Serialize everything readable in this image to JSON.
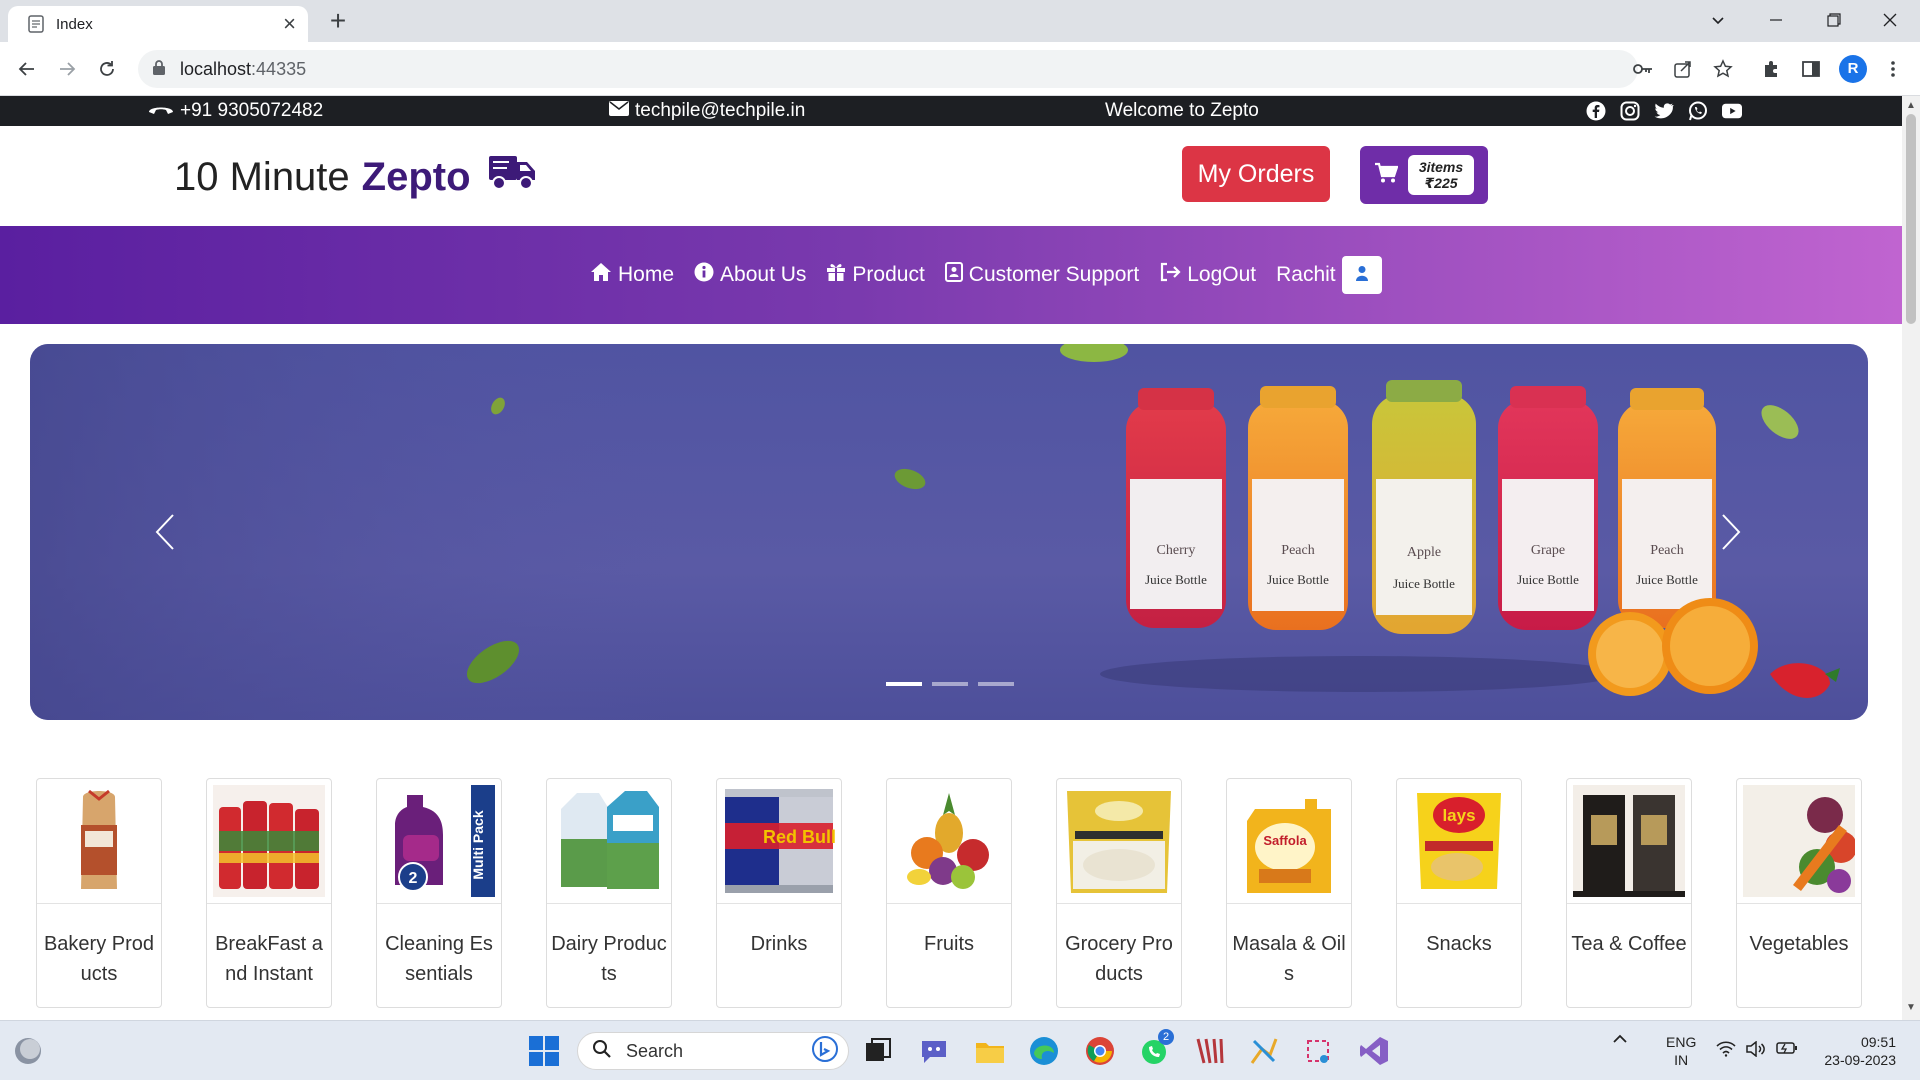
{
  "browser": {
    "tab_title": "Index",
    "url_host": "localhost",
    "url_port": ":44335",
    "profile_initial": "R"
  },
  "topstrip": {
    "phone": "+91 9305072482",
    "email": "techpile@techpile.in",
    "welcome": "Welcome to Zepto",
    "social_icons": [
      "facebook-icon",
      "instagram-icon",
      "twitter-icon",
      "whatsapp-icon",
      "youtube-icon"
    ]
  },
  "brand": {
    "prefix": "10 Minute",
    "name": "Zepto",
    "brand_color": "#3d1a78"
  },
  "header": {
    "my_orders_label": "My Orders",
    "cart_items": "3items",
    "cart_total": "₹225",
    "my_orders_color": "#dc3545",
    "cart_color": "#6f2da8"
  },
  "nav": {
    "home": "Home",
    "about": "About Us",
    "product": "Product",
    "support": "Customer Support",
    "logout": "LogOut",
    "user_name": "Rachit"
  },
  "carousel": {
    "bottle_labels": [
      "Cherry",
      "Peach",
      "Apple",
      "Grape",
      "Peach"
    ],
    "bottle_caption": "Juice Bottle",
    "active_slide": 1,
    "slides": 3
  },
  "categories": [
    {
      "name": "Bakery Products"
    },
    {
      "name": "BreakFast and Instant"
    },
    {
      "name": "Cleaning Essentials"
    },
    {
      "name": "Dairy Products"
    },
    {
      "name": "Drinks"
    },
    {
      "name": "Fruits"
    },
    {
      "name": "Grocery Products"
    },
    {
      "name": "Masala & Oils"
    },
    {
      "name": "Snacks"
    },
    {
      "name": "Tea & Coffee"
    },
    {
      "name": "Vegetables"
    }
  ],
  "taskbar": {
    "search_placeholder": "Search",
    "whatsapp_badge": "2",
    "lang_top": "ENG",
    "lang_bottom": "IN",
    "time": "09:51",
    "date": "23-09-2023"
  }
}
